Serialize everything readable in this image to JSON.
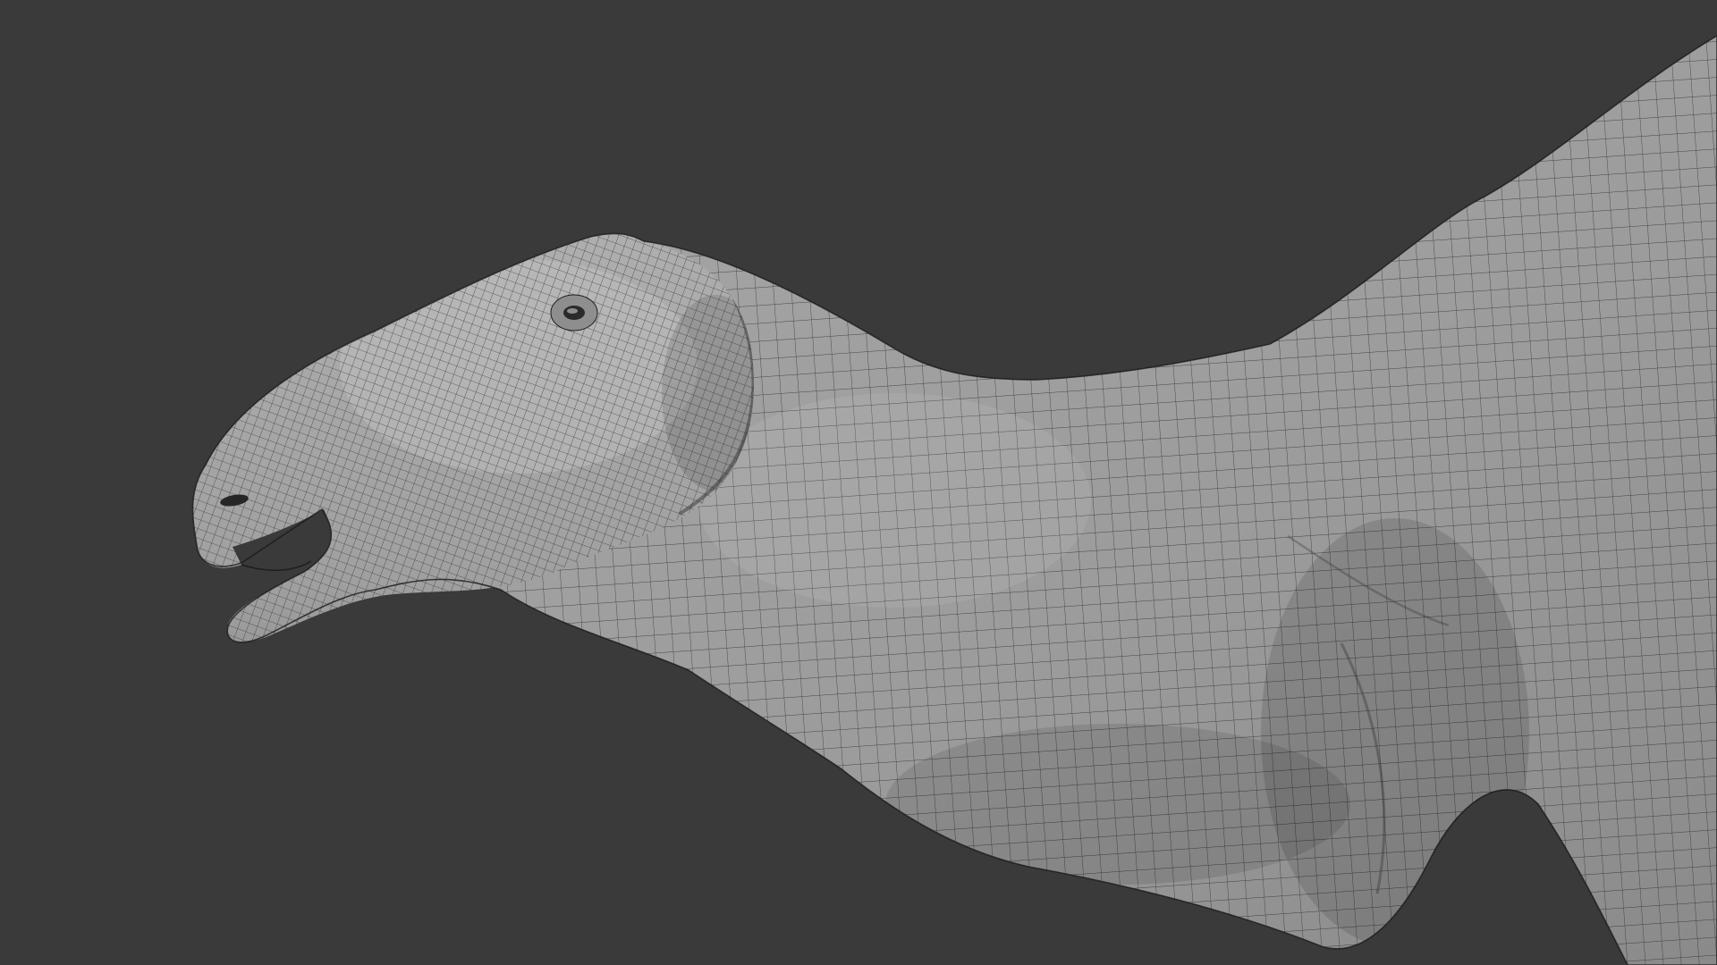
{
  "viewport": {
    "background": "#3a3a3b",
    "mesh_fill": "#9c9c9c",
    "mesh_highlight": "#b4b4b4",
    "mesh_shadow": "#707070",
    "wire_color": "#1e1e1e",
    "subject": "dinosaur-head-wireframe-mesh"
  }
}
